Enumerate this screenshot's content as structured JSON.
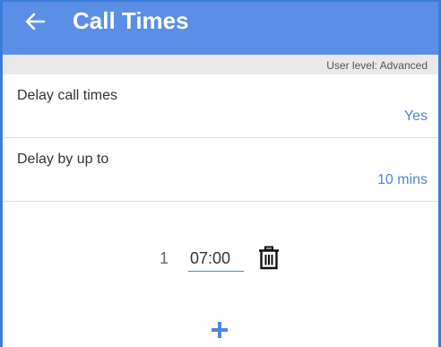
{
  "appbar": {
    "title": "Call Times",
    "back_icon": "arrow-left-icon",
    "color": "#5b8fe6"
  },
  "user_level": {
    "text": "User level: Advanced"
  },
  "settings": [
    {
      "label": "Delay call times",
      "value": "Yes"
    },
    {
      "label": "Delay by up to",
      "value": "10 mins"
    }
  ],
  "call_times": [
    {
      "index": "1",
      "time": "07:00",
      "delete_icon": "trash-icon"
    }
  ],
  "add_button": {
    "icon": "plus-icon"
  },
  "colors": {
    "accent": "#4f86d9",
    "border": "#3a7dd8"
  }
}
